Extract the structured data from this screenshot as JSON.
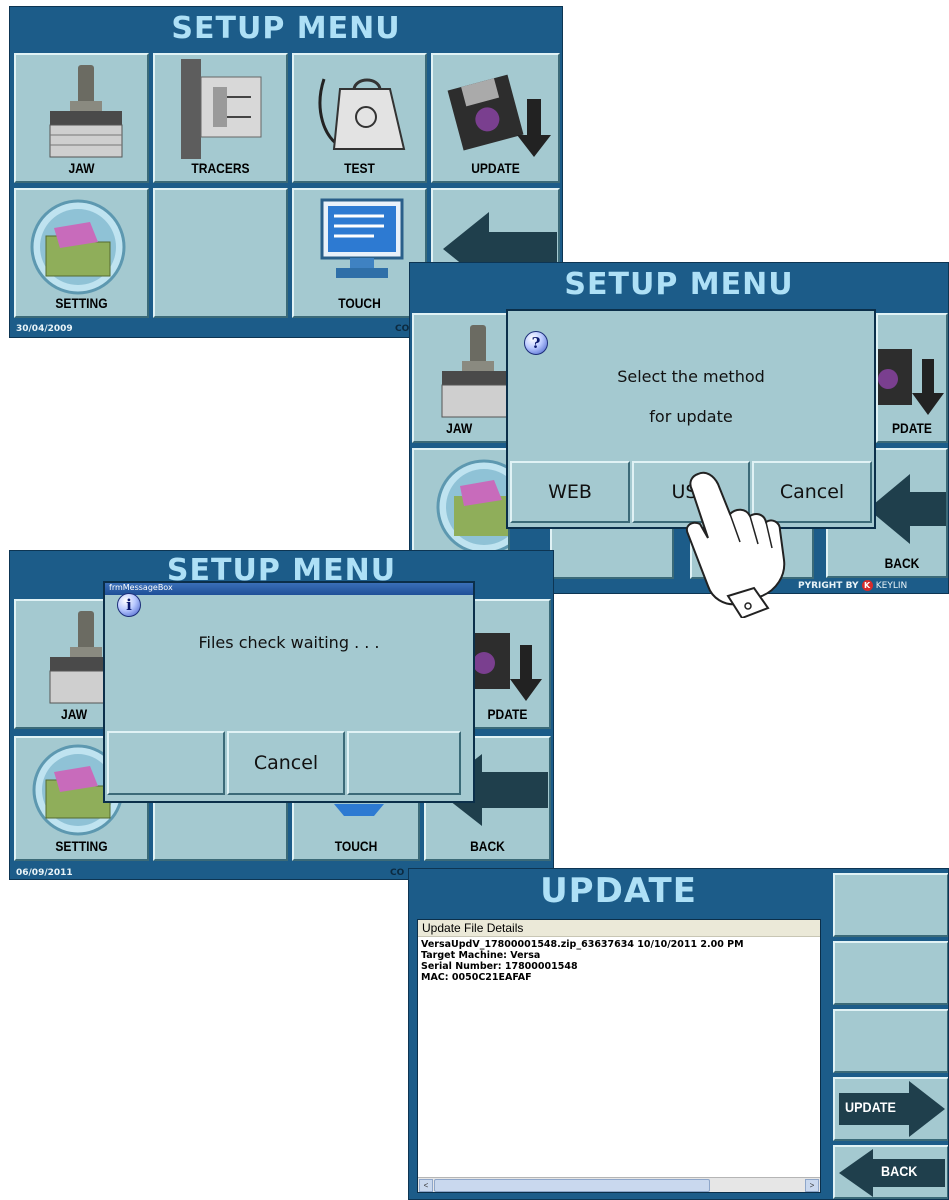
{
  "screen1": {
    "title": "SETUP MENU",
    "tiles": [
      "JAW",
      "TRACERS",
      "TEST",
      "UPDATE",
      "SETTING",
      "",
      "TOUCH",
      ""
    ],
    "date": "30/04/2009",
    "footer": "CO"
  },
  "screen2": {
    "title": "SETUP MENU",
    "tiles": [
      "JAW",
      "PDATE",
      "BACK"
    ],
    "dialog": {
      "line1": "Select the method",
      "line2": "for update",
      "buttons": [
        "WEB",
        "USB",
        "Cancel"
      ]
    },
    "footer": "PYRIGHT BY",
    "brand": "KEYLIN"
  },
  "screen3": {
    "title": "SETUP MENU",
    "tiles": [
      "JAW",
      "PDATE",
      "SETTING",
      "TOUCH",
      "BACK"
    ],
    "dialog": {
      "caption": "frmMessageBox",
      "message": "Files check waiting . . .",
      "buttons": [
        "",
        "Cancel",
        ""
      ]
    },
    "date": "06/09/2011",
    "footer": "CO"
  },
  "screen4": {
    "title": "UPDATE",
    "details_header": "Update File Details",
    "details_lines": [
      "VersaUpdV_17800001548.zip_63637634 10/10/2011 2.00 PM",
      "Target Machine: Versa",
      "Serial Number: 17800001548",
      "MAC: 0050C21EAFAF"
    ],
    "buttons": [
      "",
      "",
      "",
      "UPDATE",
      "BACK"
    ],
    "scroll_left": "<",
    "scroll_right": ">"
  },
  "colors": {
    "panel": "#1c5c89",
    "title": "#aee0f6",
    "tile": "#a4c9d0",
    "arrow": "#1f3f4c"
  }
}
